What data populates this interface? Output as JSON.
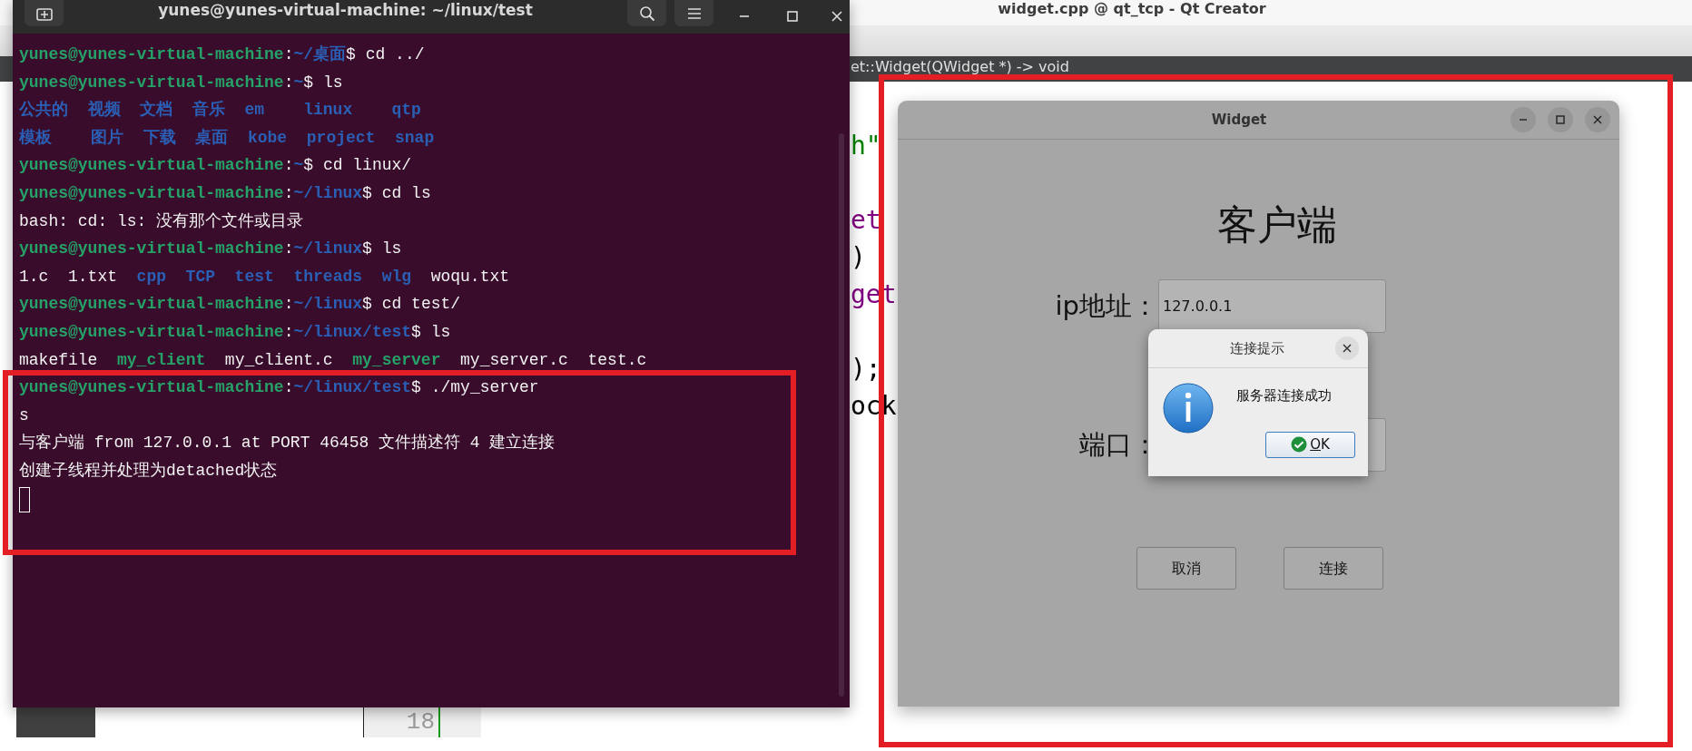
{
  "qt_creator": {
    "title": "widget.cpp @ qt_tcp - Qt Creator",
    "function_bar": "et::Widget(QWidget *) -> void",
    "code_lines": [
      {
        "kind": "string",
        "text": "h\""
      },
      {
        "kind": "blank"
      },
      {
        "kind": "type",
        "text": "et"
      },
      {
        "kind": "plain",
        "text": ")"
      },
      {
        "kind": "type",
        "text": "get"
      },
      {
        "kind": "blank"
      },
      {
        "kind": "plain",
        "text": ");"
      },
      {
        "kind": "plain",
        "text": "ock"
      }
    ],
    "line_number": "18"
  },
  "terminal": {
    "title": "yunes@yunes-virtual-machine: ~/linux/test",
    "lines": [
      {
        "kind": "text",
        "segments": [
          {
            "kind": "user",
            "text": "yunes@yunes-virtual-machine"
          },
          {
            "kind": "plain",
            "text": ":"
          },
          {
            "kind": "path",
            "text": "~/桌面"
          },
          {
            "kind": "plain",
            "text": "$ cd ../"
          }
        ]
      },
      {
        "kind": "text",
        "segments": [
          {
            "kind": "user",
            "text": "yunes@yunes-virtual-machine"
          },
          {
            "kind": "plain",
            "text": ":"
          },
          {
            "kind": "path",
            "text": "~"
          },
          {
            "kind": "plain",
            "text": "$ ls"
          }
        ]
      },
      {
        "kind": "listing",
        "rows": [
          [
            {
              "kind": "dir",
              "text": "公共的"
            },
            {
              "kind": "dir",
              "text": "视频"
            },
            {
              "kind": "dir",
              "text": "文档"
            },
            {
              "kind": "dir",
              "text": "音乐"
            },
            {
              "kind": "dir",
              "text": "em"
            },
            {
              "kind": "dir",
              "text": "linux"
            },
            {
              "kind": "dir",
              "text": "qtp"
            }
          ],
          [
            {
              "kind": "dir",
              "text": "模板"
            },
            {
              "kind": "dir",
              "text": "图片"
            },
            {
              "kind": "dir",
              "text": "下载"
            },
            {
              "kind": "dir",
              "text": "桌面"
            },
            {
              "kind": "dir",
              "text": "kobe"
            },
            {
              "kind": "dir",
              "text": "project"
            },
            {
              "kind": "dir",
              "text": "snap"
            }
          ]
        ]
      },
      {
        "kind": "text",
        "segments": [
          {
            "kind": "user",
            "text": "yunes@yunes-virtual-machine"
          },
          {
            "kind": "plain",
            "text": ":"
          },
          {
            "kind": "path",
            "text": "~"
          },
          {
            "kind": "plain",
            "text": "$ cd linux/"
          }
        ]
      },
      {
        "kind": "text",
        "segments": [
          {
            "kind": "user",
            "text": "yunes@yunes-virtual-machine"
          },
          {
            "kind": "plain",
            "text": ":"
          },
          {
            "kind": "path",
            "text": "~/linux"
          },
          {
            "kind": "plain",
            "text": "$ cd ls"
          }
        ]
      },
      {
        "kind": "text",
        "segments": [
          {
            "kind": "plain",
            "text": "bash: cd: ls: 没有那个文件或目录"
          }
        ]
      },
      {
        "kind": "text",
        "segments": [
          {
            "kind": "user",
            "text": "yunes@yunes-virtual-machine"
          },
          {
            "kind": "plain",
            "text": ":"
          },
          {
            "kind": "path",
            "text": "~/linux"
          },
          {
            "kind": "plain",
            "text": "$ ls"
          }
        ]
      },
      {
        "kind": "listing",
        "rows": [
          [
            {
              "kind": "file",
              "text": "1.c"
            },
            {
              "kind": "file",
              "text": "1.txt"
            },
            {
              "kind": "dir",
              "text": "cpp"
            },
            {
              "kind": "dir",
              "text": "TCP"
            },
            {
              "kind": "dir",
              "text": "test"
            },
            {
              "kind": "dir",
              "text": "threads"
            },
            {
              "kind": "dir",
              "text": "wlg"
            },
            {
              "kind": "file",
              "text": "woqu.txt"
            }
          ]
        ]
      },
      {
        "kind": "text",
        "segments": [
          {
            "kind": "user",
            "text": "yunes@yunes-virtual-machine"
          },
          {
            "kind": "plain",
            "text": ":"
          },
          {
            "kind": "path",
            "text": "~/linux"
          },
          {
            "kind": "plain",
            "text": "$ cd test/"
          }
        ]
      },
      {
        "kind": "text",
        "segments": [
          {
            "kind": "user",
            "text": "yunes@yunes-virtual-machine"
          },
          {
            "kind": "plain",
            "text": ":"
          },
          {
            "kind": "path",
            "text": "~/linux/test"
          },
          {
            "kind": "plain",
            "text": "$ ls"
          }
        ]
      },
      {
        "kind": "listing",
        "rows": [
          [
            {
              "kind": "file",
              "text": "makefile"
            },
            {
              "kind": "exec",
              "text": "my_client"
            },
            {
              "kind": "file",
              "text": "my_client.c"
            },
            {
              "kind": "exec",
              "text": "my_server"
            },
            {
              "kind": "file",
              "text": "my_server.c"
            },
            {
              "kind": "file",
              "text": "test.c"
            }
          ]
        ]
      },
      {
        "kind": "text",
        "segments": [
          {
            "kind": "user",
            "text": "yunes@yunes-virtual-machine"
          },
          {
            "kind": "plain",
            "text": ":"
          },
          {
            "kind": "path",
            "text": "~/linux/test"
          },
          {
            "kind": "plain",
            "text": "$ ./my_server"
          }
        ]
      },
      {
        "kind": "text",
        "segments": [
          {
            "kind": "plain",
            "text": "s"
          }
        ]
      },
      {
        "kind": "text",
        "segments": [
          {
            "kind": "plain",
            "text": "与客户端 from 127.0.0.1 at PORT 46458 文件描述符 4 建立连接"
          }
        ]
      },
      {
        "kind": "text",
        "segments": [
          {
            "kind": "plain",
            "text": "创建子线程并处理为detached状态"
          }
        ]
      },
      {
        "kind": "cursor"
      }
    ]
  },
  "widget": {
    "title": "Widget",
    "heading": "客户端",
    "fields": [
      {
        "label": "ip地址：",
        "value": "127.0.0.1"
      },
      {
        "label": "端口："
      }
    ],
    "buttons": [
      "取消",
      "连接"
    ]
  },
  "dialog": {
    "title": "连接提示",
    "message": "服务器连接成功",
    "button": "OK"
  },
  "annotations": [
    {
      "kind": "frame"
    },
    {
      "kind": "frame"
    }
  ]
}
